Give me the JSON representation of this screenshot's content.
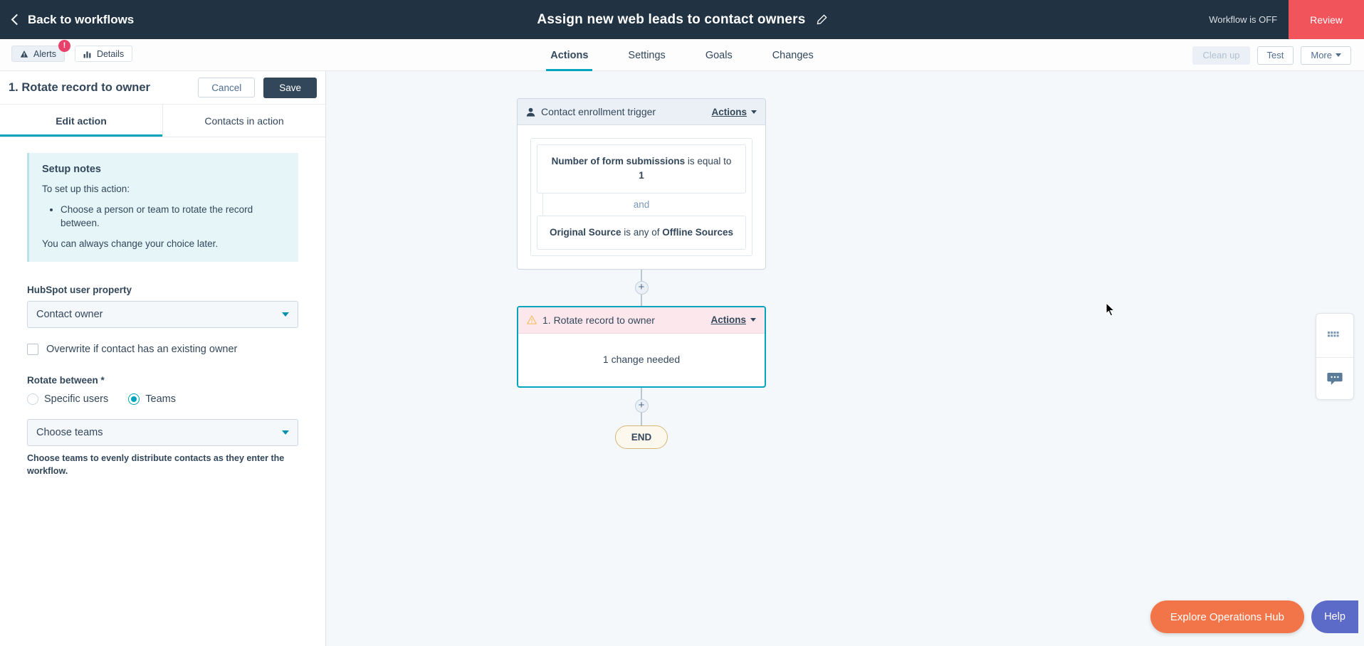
{
  "topbar": {
    "back_label": "Back to workflows",
    "workflow_title": "Assign new web leads to contact owners",
    "edit_icon": "pencil-icon",
    "status_text": "Workflow is OFF",
    "review_label": "Review"
  },
  "subbar": {
    "alerts_label": "Alerts",
    "alerts_badge": "!",
    "details_label": "Details",
    "tabs": [
      {
        "label": "Actions",
        "active": true
      },
      {
        "label": "Settings",
        "active": false
      },
      {
        "label": "Goals",
        "active": false
      },
      {
        "label": "Changes",
        "active": false
      }
    ],
    "cleanup_label": "Clean up",
    "test_label": "Test",
    "more_label": "More"
  },
  "left_panel": {
    "title": "1. Rotate record to owner",
    "cancel_label": "Cancel",
    "save_label": "Save",
    "tabs": [
      {
        "label": "Edit action",
        "active": true
      },
      {
        "label": "Contacts in action",
        "active": false
      }
    ],
    "notes": {
      "heading": "Setup notes",
      "intro": "To set up this action:",
      "bullets": [
        "Choose a person or team to rotate the record between."
      ],
      "footer": "You can always change your choice later."
    },
    "user_property": {
      "label": "HubSpot user property",
      "value": "Contact owner"
    },
    "overwrite": {
      "label": "Overwrite if contact has an existing owner",
      "checked": false
    },
    "rotate_between": {
      "label": "Rotate between *",
      "options": [
        {
          "label": "Specific users",
          "selected": false
        },
        {
          "label": "Teams",
          "selected": true
        }
      ]
    },
    "teams_select": {
      "value": "Choose teams",
      "help": "Choose teams to evenly distribute contacts as they enter the workflow."
    }
  },
  "canvas": {
    "trigger": {
      "icon": "contact-icon",
      "title": "Contact enrollment trigger",
      "actions_label": "Actions",
      "criteria": [
        {
          "bold_prefix": "Number of form submissions",
          "text": " is equal to ",
          "bold_suffix": "1"
        }
      ],
      "joiner": "and",
      "criteria2": {
        "bold_prefix": "Original Source",
        "text": " is any of ",
        "bold_suffix": "Offline Sources"
      }
    },
    "action_node": {
      "icon": "warning-icon",
      "title": "1. Rotate record to owner",
      "actions_label": "Actions",
      "body": "1 change needed"
    },
    "end_label": "END",
    "plus_label": "+"
  },
  "dock": {
    "grid_icon": "grid-icon",
    "chat_icon": "chat-bubble-icon"
  },
  "footer": {
    "ops_label": "Explore Operations Hub",
    "help_label": "Help"
  },
  "colors": {
    "dark": "#213343",
    "accent_teal": "#00a4bd",
    "review_red": "#f2545b",
    "orange": "#f2754a",
    "help_purple": "#5c6bc7"
  }
}
